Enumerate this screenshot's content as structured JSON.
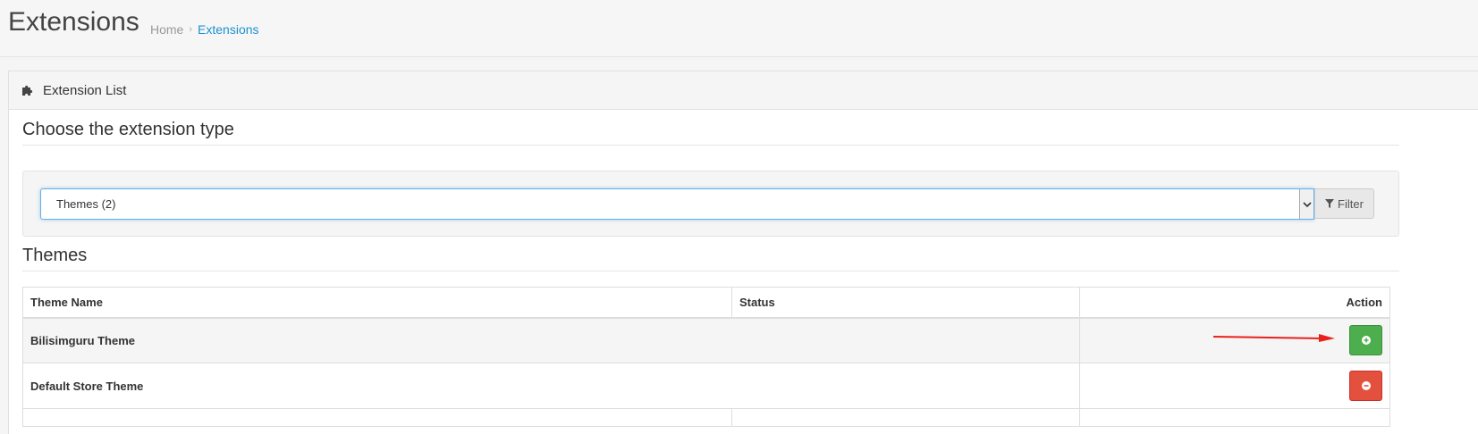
{
  "header": {
    "title": "Extensions",
    "breadcrumb": {
      "home": "Home",
      "separator": "›",
      "current": "Extensions"
    }
  },
  "panel": {
    "heading": "Extension List",
    "heading_icon": "puzzle-icon",
    "choose_title": "Choose the extension type",
    "select": {
      "value": "Themes (2)"
    },
    "filter_button": {
      "label": "Filter",
      "icon": "filter-icon"
    },
    "section_title": "Themes",
    "table": {
      "headers": [
        "Theme Name",
        "Status",
        "Action"
      ],
      "rows": [
        {
          "name": "Bilisimguru Theme",
          "status": "",
          "action": "install",
          "action_icon": "plus-circle-icon"
        },
        {
          "name": "Default Store Theme",
          "status": "",
          "action": "uninstall",
          "action_icon": "minus-circle-icon"
        }
      ]
    }
  },
  "colors": {
    "accent": "#1e91cf",
    "install": "#4cae4c",
    "uninstall": "#e3503e",
    "annotation": "#e8211c"
  }
}
